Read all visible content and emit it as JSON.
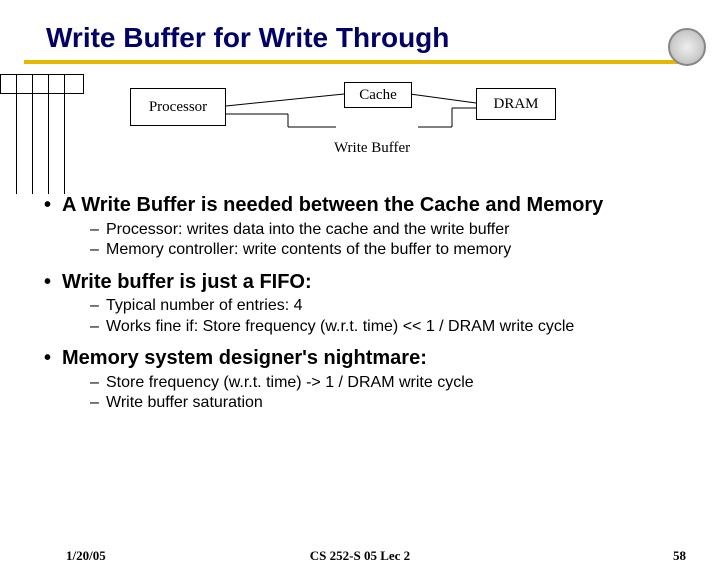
{
  "title": "Write Buffer for Write Through",
  "diagram": {
    "processor": "Processor",
    "cache": "Cache",
    "dram": "DRAM",
    "writeBuffer": "Write Buffer"
  },
  "bullets": [
    {
      "text": "A Write Buffer is needed between the Cache and Memory",
      "sub": [
        "Processor: writes data into the cache and the write buffer",
        "Memory controller: write contents of the buffer to memory"
      ]
    },
    {
      "text": "Write buffer is just a FIFO:",
      "sub": [
        "Typical number of entries: 4",
        "Works fine if:  Store frequency (w.r.t. time) << 1 / DRAM write cycle"
      ]
    },
    {
      "text": "Memory system designer's nightmare:",
      "sub": [
        "Store frequency (w.r.t. time)   ->  1 / DRAM write cycle",
        "Write buffer saturation"
      ]
    }
  ],
  "footer": {
    "date": "1/20/05",
    "mid": "CS 252-S 05 Lec 2",
    "page": "58"
  }
}
